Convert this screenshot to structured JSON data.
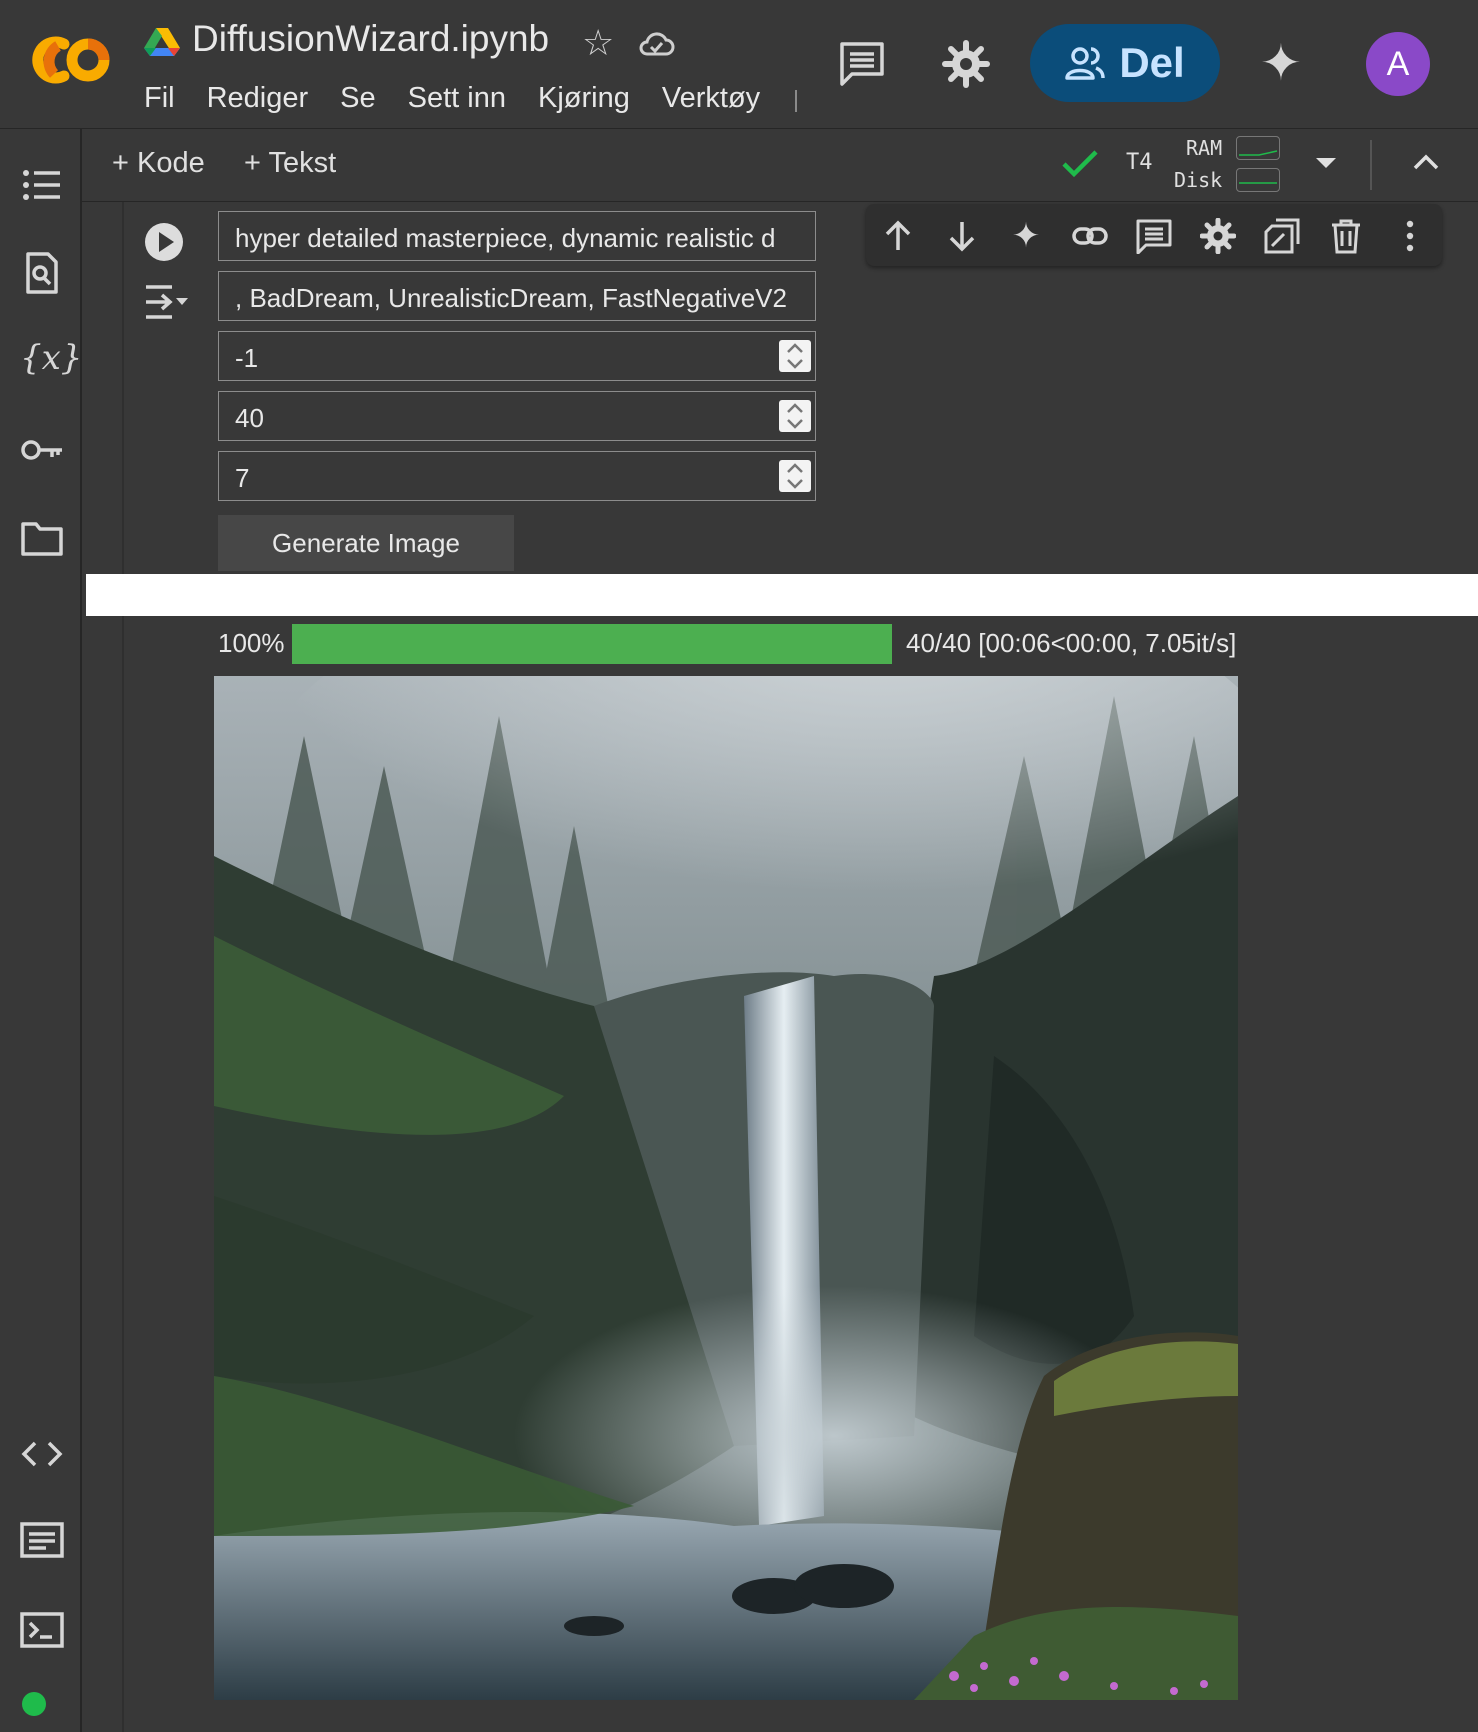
{
  "header": {
    "doc_title": "DiffusionWizard.ipynb",
    "menu": [
      "Fil",
      "Rediger",
      "Se",
      "Sett inn",
      "Kjøring",
      "Verktøy"
    ],
    "share_label": "Del",
    "avatar_initial": "A"
  },
  "toolbar": {
    "add_code_label": "+ Kode",
    "add_text_label": "+ Tekst",
    "runtime": "T4",
    "ram_label": "RAM",
    "disk_label": "Disk"
  },
  "cell": {
    "prompt_value": "hyper detailed masterpiece, dynamic realistic d",
    "negative_prompt_value": ", BadDream, UnrealisticDream, FastNegativeV2",
    "seed_value": "-1",
    "steps_value": "40",
    "guidance_value": "7",
    "generate_label": "Generate Image"
  },
  "output": {
    "progress_percent_label": "100%",
    "progress_fraction": 1.0,
    "progress_stats": "40/40 [00:06<00:00,  7.05it/s]"
  },
  "colors": {
    "accent_share": "#0b4d7a",
    "progress": "#4caf50",
    "avatar": "#8a49c8",
    "status_ok": "#1fbb4b"
  },
  "icons": [
    "colab-logo",
    "drive-icon",
    "star-icon",
    "cloud-icon",
    "comment-icon",
    "gear-icon",
    "share-people-icon",
    "gemini-sparkle-icon",
    "toc-icon",
    "find-icon",
    "variables-icon",
    "key-icon",
    "folder-icon",
    "code-snippets-icon",
    "command-palette-icon",
    "terminal-icon",
    "run-icon",
    "collapse-output-icon",
    "arrow-up-icon",
    "arrow-down-icon",
    "link-icon",
    "mirror-cell-icon",
    "delete-icon",
    "more-vert-icon"
  ]
}
